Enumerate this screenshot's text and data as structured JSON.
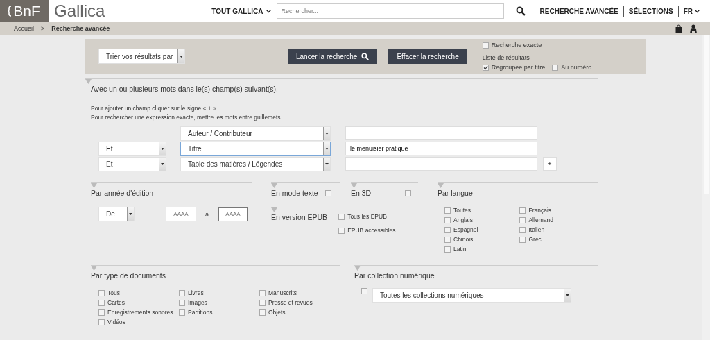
{
  "header": {
    "logo_mark": "BnF",
    "logo_text": "Gallica",
    "scope": "TOUT GALLICA",
    "search": {
      "placeholder": "Rechercher..."
    },
    "nav": [
      "RECHERCHE AVANCÉE",
      "SÉLECTIONS",
      "FR"
    ]
  },
  "breadcrumb": {
    "items": [
      "Accueil",
      "Recherche avancée"
    ],
    "separator": ">"
  },
  "toolbar": {
    "sort": "Trier vos résultats par",
    "buttons": [
      {
        "label": "Lancer la recherche",
        "kind": "search"
      },
      {
        "label": "Effacer la recherche",
        "kind": "clear"
      }
    ],
    "exact": {
      "label": "Recherche exacte",
      "checked": false
    },
    "list_label": "Liste de résultats :",
    "list_options": [
      {
        "label": "Regroupée par titre",
        "checked": true
      },
      {
        "label": "Au numéro",
        "checked": false
      }
    ]
  },
  "fields": {
    "title": "Avec un ou plusieurs mots dans le(s) champ(s) suivant(s).",
    "hints": [
      "Pour ajouter un champ cliquer sur le signe « + ».",
      "Pour rechercher une expression exacte, mettre les mots entre guillemets."
    ],
    "rows": [
      {
        "field": "Auteur / Contributeur",
        "value": "",
        "focused": false
      },
      {
        "operator": "Et",
        "field": "Titre",
        "value": "le menuisier pratique",
        "focused": true
      },
      {
        "operator": "Et",
        "field": "Table des matières / Légendes",
        "value": "",
        "focused": false
      }
    ],
    "add": "+"
  },
  "year": {
    "title": "Par année d'édition",
    "mode": "De",
    "from_placeholder": "AAAA",
    "to": "à",
    "to_placeholder": "AAAA"
  },
  "text_mode": {
    "title": "En mode texte",
    "checked": false
  },
  "three_d": {
    "title": "En 3D",
    "checked": false
  },
  "epub": {
    "title": "En version EPUB",
    "options": [
      {
        "label": "Tous les EPUB",
        "checked": false
      },
      {
        "label": "EPUB accessibles",
        "checked": false
      }
    ]
  },
  "language": {
    "title": "Par langue",
    "columns": [
      [
        {
          "label": "Toutes",
          "checked": false
        },
        {
          "label": "Anglais",
          "checked": false
        },
        {
          "label": "Espagnol",
          "checked": false
        },
        {
          "label": "Chinois",
          "checked": false
        },
        {
          "label": "Latin",
          "checked": false
        }
      ],
      [
        {
          "label": "Français",
          "checked": false
        },
        {
          "label": "Allemand",
          "checked": false
        },
        {
          "label": "Italien",
          "checked": false
        },
        {
          "label": "Grec",
          "checked": false
        }
      ]
    ]
  },
  "doc_types": {
    "title": "Par type de documents",
    "columns": [
      [
        {
          "label": "Tous",
          "checked": false
        },
        {
          "label": "Cartes",
          "checked": false
        },
        {
          "label": "Enregistrements sonores",
          "checked": false
        },
        {
          "label": "Vidéos",
          "checked": false
        }
      ],
      [
        {
          "label": "Livres",
          "checked": false
        },
        {
          "label": "Images",
          "checked": false
        },
        {
          "label": "Partitions",
          "checked": false
        }
      ],
      [
        {
          "label": "Manuscrits",
          "checked": false
        },
        {
          "label": "Presse et revues",
          "checked": false
        },
        {
          "label": "Objets",
          "checked": false
        }
      ]
    ]
  },
  "collection": {
    "title": "Par collection numérique",
    "checked": false,
    "select": "Toutes les collections numériques"
  }
}
